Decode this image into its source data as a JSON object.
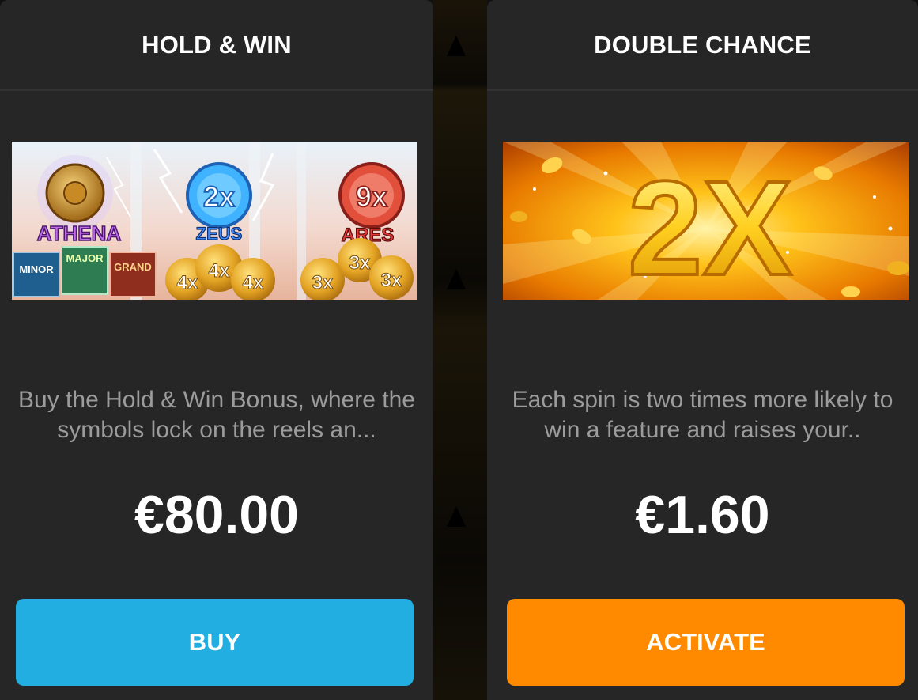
{
  "colors": {
    "card_bg": "#262626",
    "buy_button": "#22aee0",
    "activate_button": "#ff8a00",
    "title_text": "#ffffff",
    "desc_text": "#9c9c9c"
  },
  "cards": [
    {
      "title": "HOLD & WIN",
      "banner": {
        "gods": [
          "ATHENA",
          "ZEUS",
          "ARES"
        ],
        "multipliers": [
          "2x",
          "9x"
        ],
        "jackpots": [
          "MINOR",
          "MAJOR",
          "GRAND"
        ],
        "coins": [
          "4x",
          "4x",
          "4x",
          "3x",
          "3x",
          "3x"
        ]
      },
      "description": "Buy the Hold & Win Bonus, where the symbols lock on the reels an...",
      "price": "€80.00",
      "button_label": "BUY"
    },
    {
      "title": "DOUBLE CHANCE",
      "banner": {
        "multiplier": "2X"
      },
      "description": "Each spin is two times more likely to win a feature and raises your..",
      "price": "€1.60",
      "button_label": "ACTIVATE"
    }
  ]
}
